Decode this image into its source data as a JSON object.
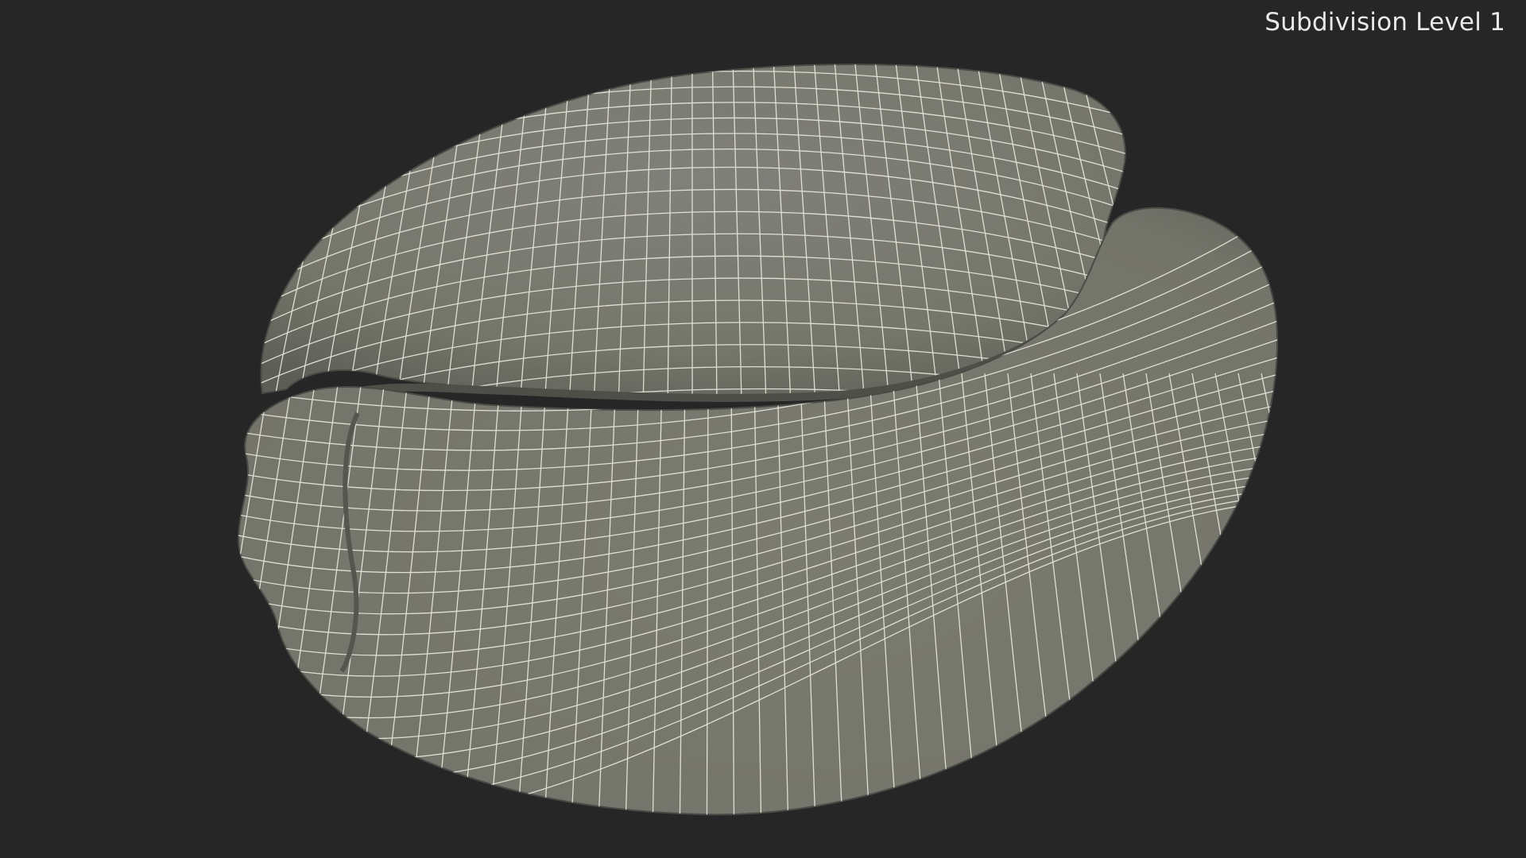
{
  "viewport": {
    "label": "Subdivision Level 1",
    "background_color": "#262626",
    "mesh_color": "#75766b",
    "wire_color": "#ecebe0"
  }
}
